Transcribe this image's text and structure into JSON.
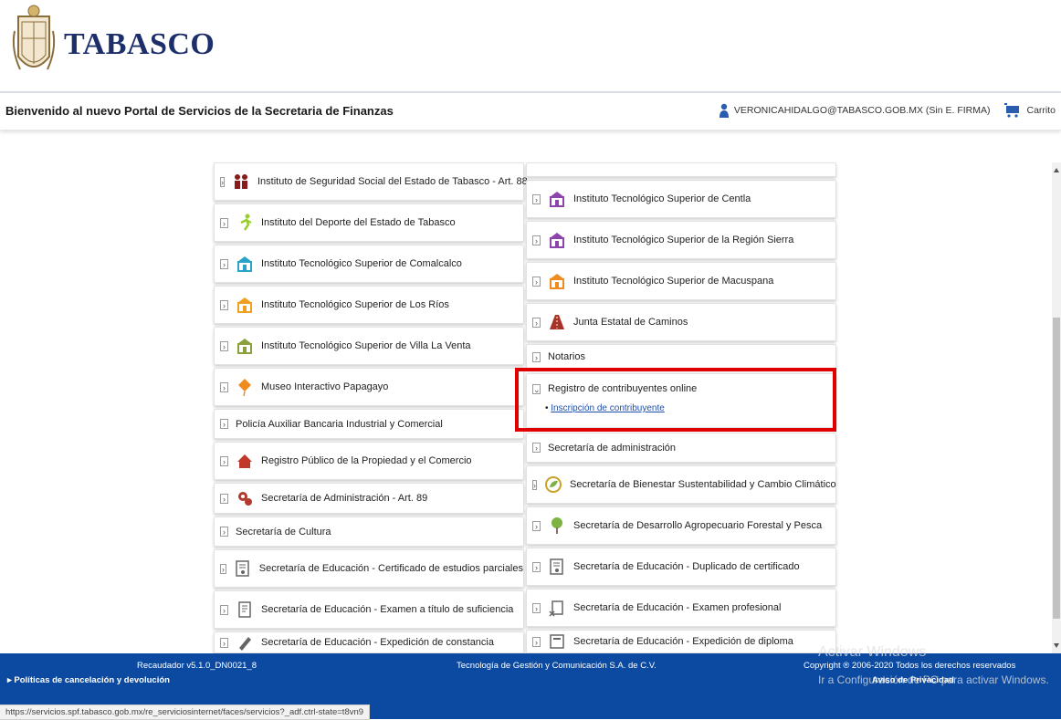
{
  "brand": {
    "name": "TABASCO"
  },
  "header": {
    "welcome": "Bienvenido al nuevo Portal de Servicios de la Secretaria de Finanzas",
    "user": "VERONICAHIDALGO@TABASCO.GOB.MX (Sin E. FIRMA)",
    "cart": "Carrito"
  },
  "left_items": [
    {
      "label": "Instituto de Seguridad Social del Estado de Tabasco - Art. 88",
      "icon": "people-icon",
      "color": "#8b1a1a"
    },
    {
      "label": "Instituto del Deporte del Estado de Tabasco",
      "icon": "runner-icon",
      "color": "#9acd32"
    },
    {
      "label": "Instituto Tecnológico Superior de Comalcalco",
      "icon": "building-icon",
      "color": "#29a3c7"
    },
    {
      "label": "Instituto Tecnológico Superior de Los Ríos",
      "icon": "building-icon",
      "color": "#f0a020"
    },
    {
      "label": "Instituto Tecnológico Superior de Villa La Venta",
      "icon": "building-icon",
      "color": "#8aa03c"
    },
    {
      "label": "Museo Interactivo Papagayo",
      "icon": "kite-icon",
      "color": "#f08c1e"
    },
    {
      "label": "Policía Auxiliar Bancaria Industrial y Comercial",
      "icon": "",
      "color": ""
    },
    {
      "label": "Registro Público de la Propiedad y el Comercio",
      "icon": "house-icon",
      "color": "#c0392b"
    },
    {
      "label": "Secretaría de Administración - Art. 89",
      "icon": "gears-icon",
      "color": "#b03a2e"
    },
    {
      "label": "Secretaría de Cultura",
      "icon": "",
      "color": ""
    },
    {
      "label": "Secretaría de Educación - Certificado de estudios parciales",
      "icon": "certificate-icon",
      "color": "#666666"
    },
    {
      "label": "Secretaría de Educación - Examen a título de suficiencia",
      "icon": "document-icon",
      "color": "#666666"
    },
    {
      "label": "Secretaría de Educación - Expedición de constancia",
      "icon": "pencil-icon",
      "color": "#666666"
    }
  ],
  "right_items": [
    {
      "label": "Instituto Tecnológico Superior de Centla",
      "icon": "building-icon",
      "color": "#8e44ad"
    },
    {
      "label": "Instituto Tecnológico Superior de la Región Sierra",
      "icon": "building-icon",
      "color": "#8e44ad"
    },
    {
      "label": "Instituto Tecnológico Superior de Macuspana",
      "icon": "building-icon",
      "color": "#f08c1e"
    },
    {
      "label": "Junta Estatal de Caminos",
      "icon": "road-icon",
      "color": "#a93226"
    },
    {
      "label": "Notarios",
      "icon": "",
      "color": ""
    },
    {
      "label": "Registro de contribuyentes online",
      "icon": "",
      "color": "",
      "expanded": true,
      "sub": "Inscripción de contribuyente"
    },
    {
      "label": "Secretaría de administración",
      "icon": "",
      "color": ""
    },
    {
      "label": "Secretaría de Bienestar Sustentabilidad y Cambio Climático",
      "icon": "leaf-circle-icon",
      "color": "#c9a227"
    },
    {
      "label": "Secretaría de Desarrollo Agropecuario Forestal y Pesca",
      "icon": "tree-icon",
      "color": "#7cb342"
    },
    {
      "label": "Secretaría de Educación - Duplicado de certificado",
      "icon": "certificate-icon",
      "color": "#666666"
    },
    {
      "label": "Secretaría de Educación - Examen profesional",
      "icon": "exam-icon",
      "color": "#666666"
    },
    {
      "label": "Secretaría de Educación - Expedición de diploma",
      "icon": "diploma-icon",
      "color": "#666666"
    }
  ],
  "footer": {
    "version": "Recaudador v5.1.0_DN0021_8",
    "policies": "▸ Políticas de cancelación y devolución",
    "company": "Tecnología de Gestión y Comunicación S.A. de C.V.",
    "copyright": "Copyright ® 2006-2020 Todos los derechos reservados",
    "privacy": "Aviso de Privacidad"
  },
  "watermark": {
    "line1": "Activar Windows",
    "line2": "Ir a Configuración de PC para activar Windows."
  },
  "status_url": "https://servicios.spf.tabasco.gob.mx/re_serviciosinternet/faces/servicios?_adf.ctrl-state=t8vn9"
}
